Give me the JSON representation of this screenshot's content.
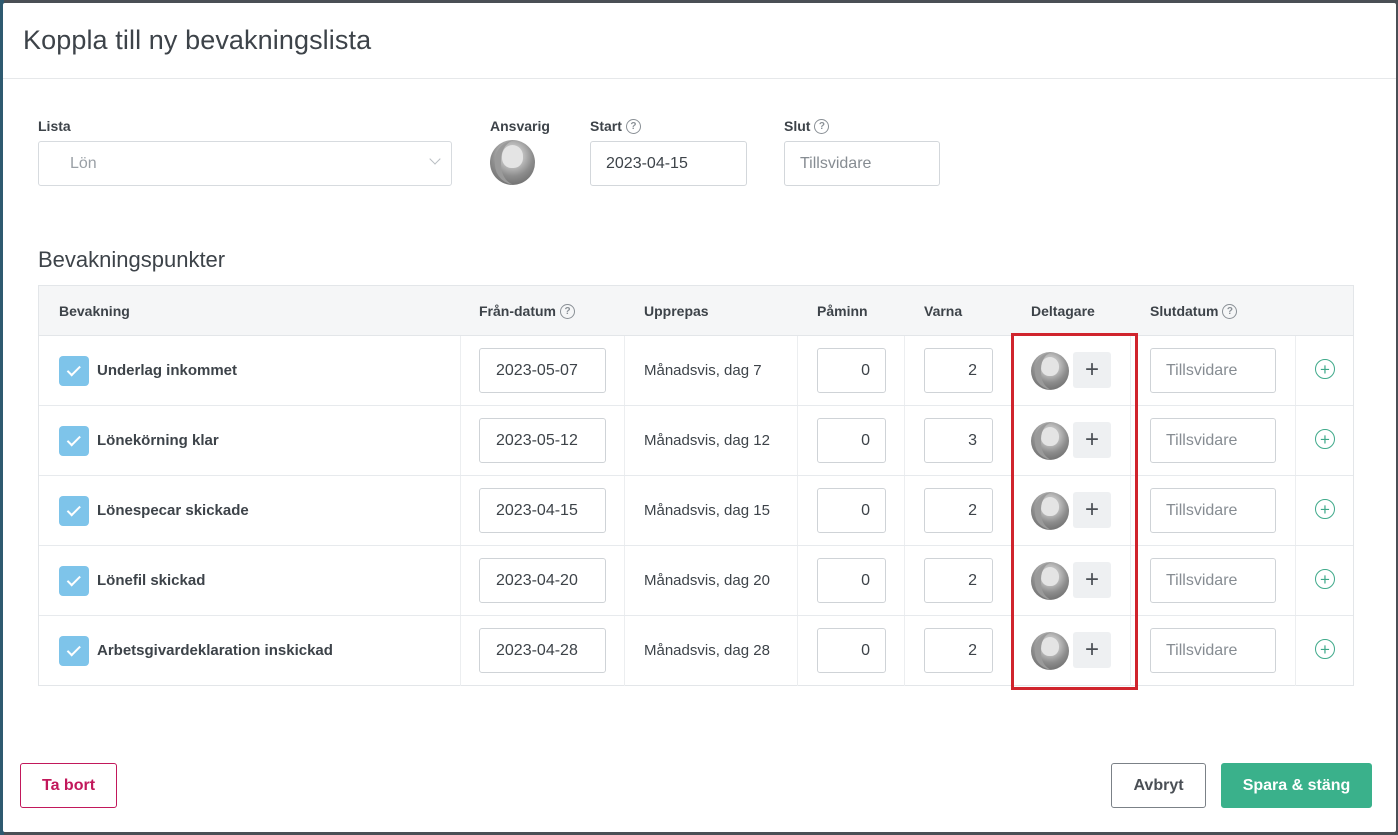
{
  "modal": {
    "title": "Koppla till ny bevakningslista"
  },
  "form": {
    "list_label": "Lista",
    "list_value": "Lön",
    "responsible_label": "Ansvarig",
    "start_label": "Start",
    "start_value": "2023-04-15",
    "end_label": "Slut",
    "end_placeholder": "Tillsvidare"
  },
  "section": {
    "title": "Bevakningspunkter"
  },
  "table": {
    "headers": {
      "monitoring": "Bevakning",
      "from_date": "Från-datum",
      "repeat": "Upprepas",
      "remind": "Påminn",
      "warn": "Varna",
      "participants": "Deltagare",
      "end_date": "Slutdatum"
    },
    "rows": [
      {
        "name": "Underlag inkommet",
        "from_date": "2023-05-07",
        "repeat": "Månadsvis, dag 7",
        "remind": "0",
        "warn": "2",
        "end_date": "Tillsvidare"
      },
      {
        "name": "Lönekörning klar",
        "from_date": "2023-05-12",
        "repeat": "Månadsvis, dag 12",
        "remind": "0",
        "warn": "3",
        "end_date": "Tillsvidare"
      },
      {
        "name": "Lönespecar skickade",
        "from_date": "2023-04-15",
        "repeat": "Månadsvis, dag 15",
        "remind": "0",
        "warn": "2",
        "end_date": "Tillsvidare"
      },
      {
        "name": "Lönefil skickad",
        "from_date": "2023-04-20",
        "repeat": "Månadsvis, dag 20",
        "remind": "0",
        "warn": "2",
        "end_date": "Tillsvidare"
      },
      {
        "name": "Arbetsgivardeklaration inskickad",
        "from_date": "2023-04-28",
        "repeat": "Månadsvis, dag 28",
        "remind": "0",
        "warn": "2",
        "end_date": "Tillsvidare"
      }
    ]
  },
  "footer": {
    "delete_label": "Ta bort",
    "cancel_label": "Avbryt",
    "save_label": "Spara & stäng"
  },
  "colors": {
    "accent_green": "#3ab18b",
    "delete_red": "#c2185b",
    "checkbox_blue": "#7ec4ea",
    "highlight_red": "#d0242d"
  },
  "icons": {
    "help": "question-circle-icon",
    "check": "checkmark-icon",
    "plus": "plus-icon",
    "add": "plus-circle-icon",
    "chevron": "chevron-down-icon"
  }
}
